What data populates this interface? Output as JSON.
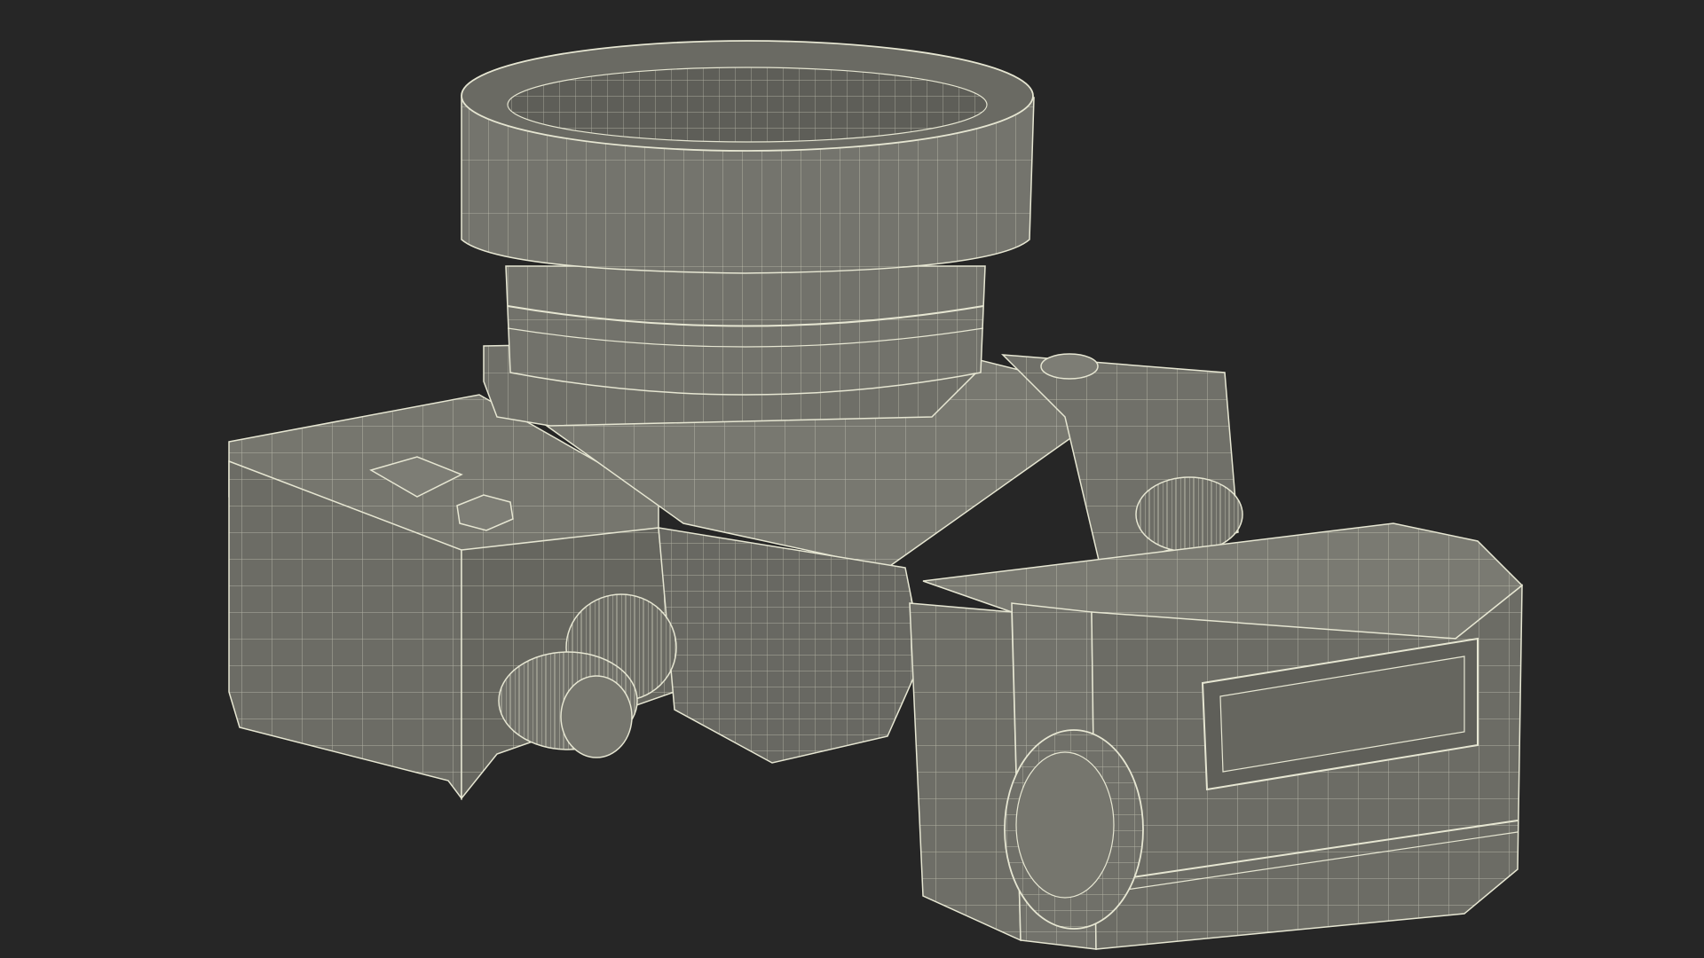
{
  "scene": {
    "subject": "camera-wireframe-render",
    "colors": {
      "background": "#262626",
      "surface": "#6f6f68",
      "surface_dark": "#5c5c56",
      "surface_light": "#7b7b73",
      "wire": "#e6e6d2"
    }
  }
}
